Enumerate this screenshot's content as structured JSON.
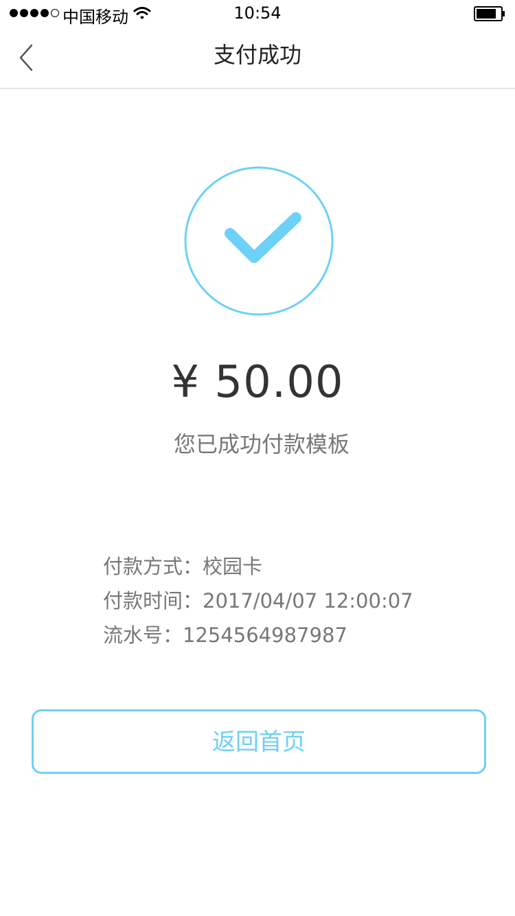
{
  "status_bar": {
    "carrier": "中国移动",
    "time": "10:54",
    "signal_icon": "signal-dots-icon",
    "wifi_icon": "wifi-icon",
    "battery_icon": "battery-icon"
  },
  "nav": {
    "title": "支付成功",
    "back_icon": "chevron-left-icon"
  },
  "result": {
    "icon": "checkmark-circle-icon",
    "accent_color": "#6cd0f7",
    "amount": "¥ 50.00",
    "message": "您已成功付款模板"
  },
  "details": {
    "payment_method": "付款方式：校园卡",
    "payment_time": "付款时间：2017/04/07 12:00:07",
    "serial_number": "流水号：1254564987987"
  },
  "actions": {
    "home_label": "返回首页"
  }
}
